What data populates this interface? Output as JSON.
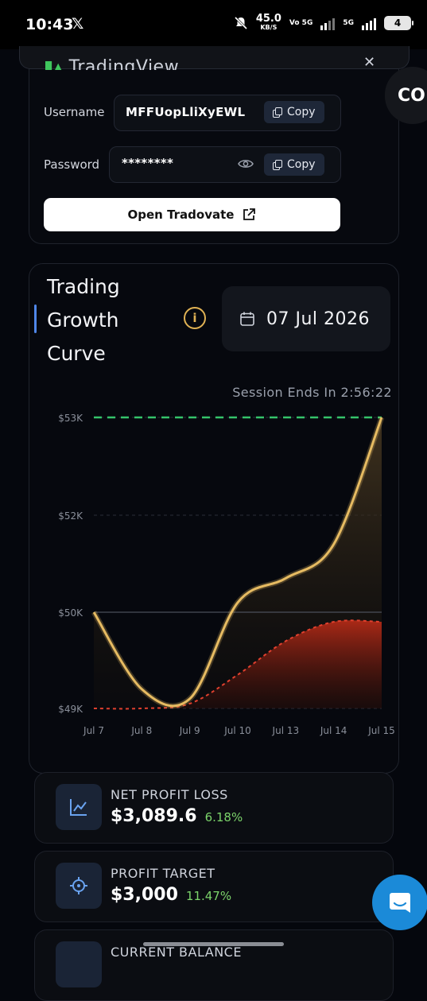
{
  "status_bar": {
    "time": "10:43",
    "x_icon": "𝕏",
    "speed_value": "45.0",
    "speed_unit": "KB/S",
    "volte": "Vo 5G",
    "network": "5G",
    "battery": "4"
  },
  "credentials": {
    "brand": "TradingView",
    "username_label": "Username",
    "username_value": "MFFUopLliXyEWL",
    "password_label": "Password",
    "password_value": "********",
    "copy_label": "Copy",
    "open_button": "Open Tradovate"
  },
  "side_badge": "CO",
  "growth": {
    "title_line1": "Trading",
    "title_line2": "Growth",
    "title_line3": "Curve",
    "date": "07 Jul 2026",
    "session_text": "Session Ends In 2:56:22"
  },
  "chart_data": {
    "type": "line",
    "x": [
      "Jul 7",
      "Jul 8",
      "Jul 9",
      "Jul 10",
      "Jul 13",
      "Jul 14",
      "Jul 15"
    ],
    "y_ticks": [
      "$53K",
      "$52K",
      "$50K",
      "$49K"
    ],
    "series": [
      {
        "values": [
          50000,
          49200,
          49100,
          50200,
          50700,
          51400,
          53000
        ],
        "color": "#e6bb62"
      },
      {
        "values": [
          49000,
          49000,
          49050,
          49350,
          49700,
          49900,
          49900
        ],
        "color": "#e0402e"
      }
    ],
    "target_line": 53000,
    "grid": true
  },
  "metrics": [
    {
      "label": "NET PROFIT LOSS",
      "value": "$3,089.6",
      "pct": "6.18%"
    },
    {
      "label": "PROFIT TARGET",
      "value": "$3,000",
      "pct": "11.47%"
    },
    {
      "label": "CURRENT BALANCE",
      "value": "",
      "pct": ""
    }
  ],
  "colors": {
    "accent_blue": "#4f86e8",
    "gold": "#e6bb62",
    "red": "#e0402e",
    "green_target": "#35c46a",
    "positive": "#7bd36a"
  }
}
